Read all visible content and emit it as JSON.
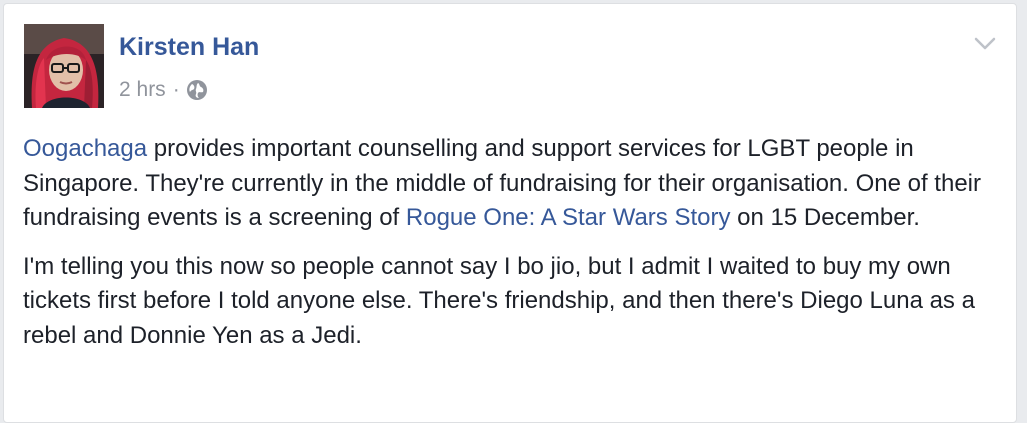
{
  "post": {
    "author": "Kirsten Han",
    "timestamp": "2 hrs",
    "separator": "·",
    "privacy_icon": "globe-icon",
    "menu_icon": "chevron-down-icon",
    "colors": {
      "link": "#365899",
      "text": "#1d2129",
      "meta": "#90949c"
    },
    "paragraph1": {
      "link_oogachaga": "Oogachaga",
      "text_a": " provides important counselling and support services for LGBT people in Singapore. They're currently in the middle of fundraising for their organisation. One of their fundraising events is a screening of ",
      "link_rogue_one": "Rogue One: A Star Wars Story",
      "text_b": " on 15 December."
    },
    "paragraph2": "I'm telling you this now so people cannot say I bo jio, but I admit I waited to buy my own tickets first before I told anyone else. There's friendship, and then there's Diego Luna as a rebel and Donnie Yen as a Jedi."
  }
}
